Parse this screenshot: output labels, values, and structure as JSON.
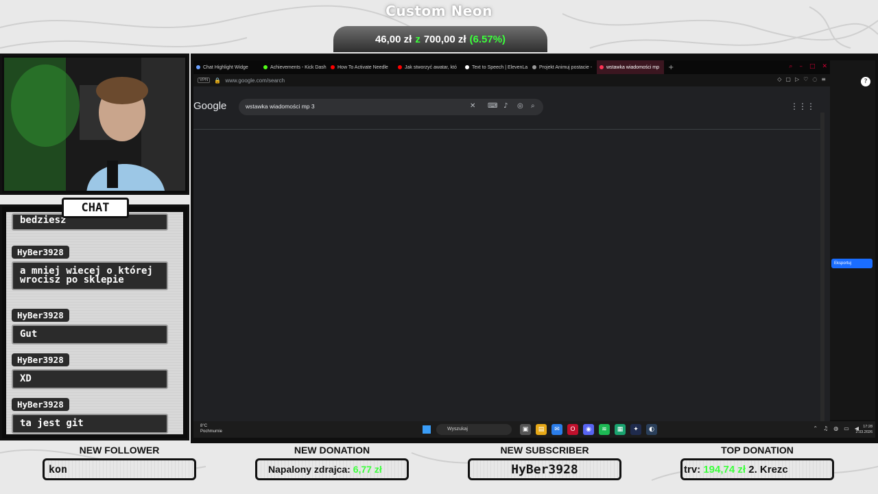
{
  "goal": {
    "title": "Custom Neon",
    "current": "46,00 zł",
    "separator": "z",
    "target": "700,00 zł",
    "percent": "(6.57%)"
  },
  "chat": {
    "tab_label": "CHAT",
    "messages": [
      {
        "user": "",
        "text": "bedziesz"
      },
      {
        "user": "HyBer3928",
        "text": "a mniej wiecej o której wrocisz po sklepie"
      },
      {
        "user": "HyBer3928",
        "text": "Gut"
      },
      {
        "user": "HyBer3928",
        "text": "XD"
      },
      {
        "user": "HyBer3928",
        "text": "ta jest git"
      }
    ]
  },
  "browser": {
    "tabs": [
      {
        "label": "Chat Highlight Widge",
        "color": "#6aa0ff"
      },
      {
        "label": "Achievements - Kick Dash",
        "color": "#53fc18"
      },
      {
        "label": "How To Activate Needle",
        "color": "#ff0000"
      },
      {
        "label": "Jak stworzyć awatar, któ",
        "color": "#ff0000"
      },
      {
        "label": "Text to Speech | ElevenLa",
        "color": "#ffffff"
      },
      {
        "label": "Projekt Animuj postacie -",
        "color": "#999999"
      },
      {
        "label": "wstawka wiadomości mp",
        "color": "#ff3355"
      }
    ],
    "vpn_label": "VPN",
    "url": "www.google.com/search",
    "logo": "Google",
    "search_query": "wstawka wiadomości mp 3"
  },
  "taskbar": {
    "weather_temp": "8°C",
    "weather_desc": "Pochmurnie",
    "search_placeholder": "Wyszukaj",
    "time": "17:28",
    "date": "2.03.2026"
  },
  "side_panel": {
    "export_label": "Eksportuj"
  },
  "widgets": {
    "follower": {
      "title": "NEW FOLLOWER",
      "value": "kon"
    },
    "donation": {
      "title": "NEW DONATION",
      "name": "Napalony zdrajca",
      "amount": "6,77 zł"
    },
    "subscriber": {
      "title": "NEW SUBSCRIBER",
      "value": "HyBer3928"
    },
    "top": {
      "title": "TOP DONATION",
      "prefix": "trv:",
      "amount": "194,74 zł",
      "suffix": "2. Krezc"
    }
  }
}
